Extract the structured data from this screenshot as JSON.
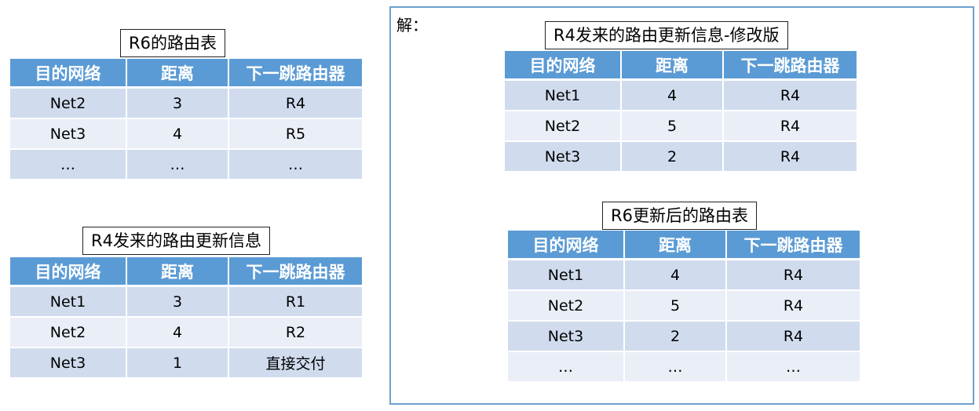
{
  "headers": [
    "目的网络",
    "距离",
    "下一跳路由器"
  ],
  "r6_table": {
    "caption": "R6的路由表",
    "rows": [
      [
        "Net2",
        "3",
        "R4"
      ],
      [
        "Net3",
        "4",
        "R5"
      ],
      [
        "…",
        "…",
        "…"
      ]
    ]
  },
  "r4_update": {
    "caption": "R4发来的路由更新信息",
    "rows": [
      [
        "Net1",
        "3",
        "R1"
      ],
      [
        "Net2",
        "4",
        "R2"
      ],
      [
        "Net3",
        "1",
        "直接交付"
      ]
    ]
  },
  "solution": {
    "label": "解：",
    "modified": {
      "caption": "R4发来的路由更新信息-修改版",
      "rows": [
        [
          "Net1",
          "4",
          "R4"
        ],
        [
          "Net2",
          "5",
          "R4"
        ],
        [
          "Net3",
          "2",
          "R4"
        ]
      ]
    },
    "updated": {
      "caption": "R6更新后的路由表",
      "rows": [
        [
          "Net1",
          "4",
          "R4"
        ],
        [
          "Net2",
          "5",
          "R4"
        ],
        [
          "Net3",
          "2",
          "R4"
        ],
        [
          "…",
          "…",
          "…"
        ]
      ]
    }
  },
  "colors": {
    "header_fill": "#5b9bd5",
    "row_fill_dark": "#d0dcee",
    "row_fill_light": "#e9eef7",
    "solution_border": "#6f9fd0"
  }
}
